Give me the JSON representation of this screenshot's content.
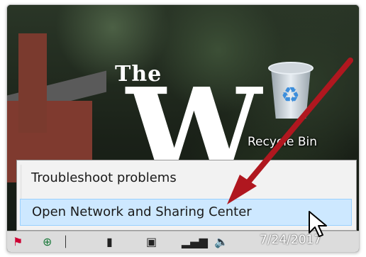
{
  "desktop": {
    "logo_the": "The",
    "logo_w": "W",
    "recycle_bin_label": "Recycle Bin"
  },
  "context_menu": {
    "items": [
      {
        "label": "Troubleshoot problems"
      },
      {
        "label": "Open Network and Sharing Center",
        "highlighted": true
      }
    ]
  },
  "taskbar": {
    "clock_date": "7/24/2017",
    "tray_icons": [
      "flag-icon",
      "network-icon",
      "battery-icon",
      "signal-icon",
      "volume-icon"
    ]
  },
  "annotation": {
    "arrow_color": "#b0171f"
  }
}
